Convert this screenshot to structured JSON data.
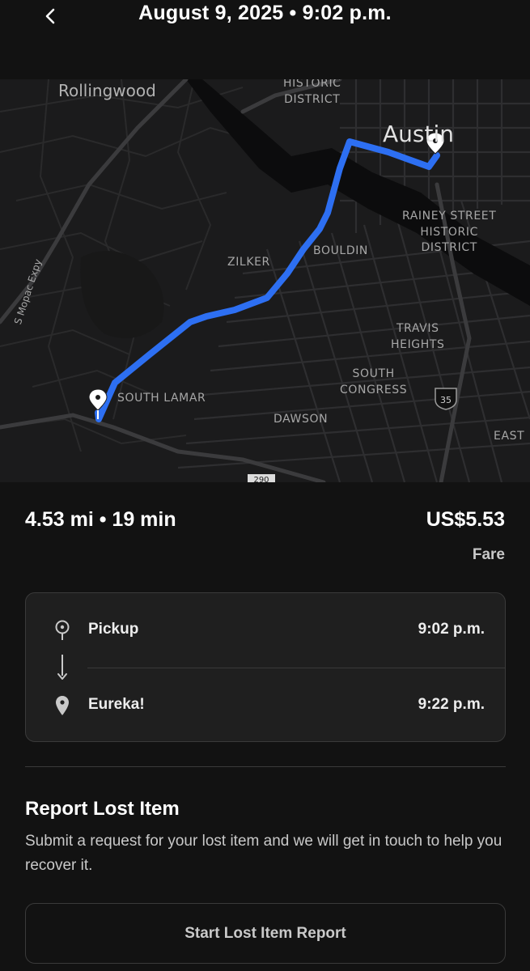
{
  "header": {
    "title": "August 9, 2025 • 9:02 p.m.",
    "back_icon": "chevron-left-icon"
  },
  "map": {
    "labels": {
      "rollingwood": "Rollingwood",
      "historic_district": "HISTORIC\nDISTRICT",
      "austin": "Austin",
      "rainey": "RAINEY STREET\nHISTORIC\nDISTRICT",
      "zilker": "ZILKER",
      "bouldin": "BOULDIN",
      "mopac": "S Mopac Expy",
      "travis": "TRAVIS\nHEIGHTS",
      "south_congress": "SOUTH\nCONGRESS",
      "south_lamar": "SOUTH LAMAR",
      "dawson": "DAWSON",
      "east": "EAST",
      "shield_35": "35",
      "shield_290": "290"
    },
    "route_color": "#2d6ff2",
    "start_icon": "location-pin-icon",
    "end_icon": "location-pin-icon"
  },
  "summary": {
    "distance_duration": "4.53 mi • 19 min",
    "price": "US$5.53",
    "price_label": "Fare"
  },
  "trip": {
    "stops": [
      {
        "name": "Pickup",
        "time": "9:02 p.m.",
        "icon": "pickup-pin-outline-icon"
      },
      {
        "name": "Eureka!",
        "time": "9:22 p.m.",
        "icon": "dropoff-pin-filled-icon"
      }
    ]
  },
  "lost_item": {
    "title": "Report Lost Item",
    "description": "Submit a request for your lost item and we will get in touch to help you recover it.",
    "button_label": "Start Lost Item Report"
  }
}
